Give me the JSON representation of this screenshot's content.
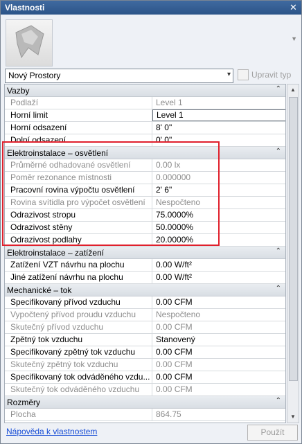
{
  "window": {
    "title": "Vlastnosti",
    "close_glyph": "✕"
  },
  "type_selector": {
    "value": "Nový Prostory",
    "chevron": "▾"
  },
  "edit_type": {
    "label": "Upravit typ"
  },
  "categories": [
    {
      "title": "Vazby",
      "rows": [
        {
          "name": "Podlaží",
          "value": "Level 1",
          "readonly": true
        },
        {
          "name": "Horní limit",
          "value": "Level 1",
          "readonly": false,
          "editing": true
        },
        {
          "name": "Horní odsazení",
          "value": "8'  0\"",
          "readonly": false
        },
        {
          "name": "Dolní odsazení",
          "value": "0'  0\"",
          "readonly": false
        }
      ]
    },
    {
      "title": "Elektroinstalace – osvětlení",
      "rows": [
        {
          "name": "Průměrné odhadované osvětlení",
          "value": "0.00 lx",
          "readonly": true
        },
        {
          "name": "Poměr rezonance místnosti",
          "value": "0.000000",
          "readonly": true
        },
        {
          "name": "Pracovní rovina výpočtu osvětlení",
          "value": "2'  6\"",
          "readonly": false
        },
        {
          "name": "Rovina svítidla pro výpočet osvětlení",
          "value": "Nespočteno",
          "readonly": true
        },
        {
          "name": "Odrazivost stropu",
          "value": "75.0000%",
          "readonly": false
        },
        {
          "name": "Odrazivost stěny",
          "value": "50.0000%",
          "readonly": false
        },
        {
          "name": "Odrazivost podlahy",
          "value": "20.0000%",
          "readonly": false
        }
      ]
    },
    {
      "title": "Elektroinstalace – zatížení",
      "rows": [
        {
          "name": "Zatížení VZT návrhu na plochu",
          "value": "0.00 W/ft²",
          "readonly": false
        },
        {
          "name": "Jiné zatížení návrhu na plochu",
          "value": "0.00 W/ft²",
          "readonly": false
        }
      ]
    },
    {
      "title": "Mechanické – tok",
      "rows": [
        {
          "name": "Specifikovaný přívod vzduchu",
          "value": "0.00 CFM",
          "readonly": false
        },
        {
          "name": "Vypočtený přívod proudu vzduchu",
          "value": "Nespočteno",
          "readonly": true
        },
        {
          "name": "Skutečný přívod vzduchu",
          "value": "0.00 CFM",
          "readonly": true
        },
        {
          "name": "Zpětný tok vzduchu",
          "value": "Stanovený",
          "readonly": false
        },
        {
          "name": "Specifikovaný zpětný tok vzduchu",
          "value": "0.00 CFM",
          "readonly": false
        },
        {
          "name": "Skutečný zpětný tok vzduchu",
          "value": "0.00 CFM",
          "readonly": true
        },
        {
          "name": "Specifikovaný tok odváděného vzdu...",
          "value": "0.00 CFM",
          "readonly": false
        },
        {
          "name": "Skutečný tok odváděného vzduchu",
          "value": "0.00 CFM",
          "readonly": true
        }
      ]
    },
    {
      "title": "Rozměry",
      "rows": [
        {
          "name": "Plocha",
          "value": "864.75",
          "readonly": true
        }
      ]
    }
  ],
  "collapse_glyph": "⌃",
  "scrollbar": {
    "up": "▲",
    "down": "▼"
  },
  "footer": {
    "help_link": "Nápověda k vlastnostem",
    "apply_button": "Použít"
  },
  "colors": {
    "title_bar": "#2c5488",
    "highlight_border": "#e0202c",
    "link": "#1a4fd6"
  }
}
